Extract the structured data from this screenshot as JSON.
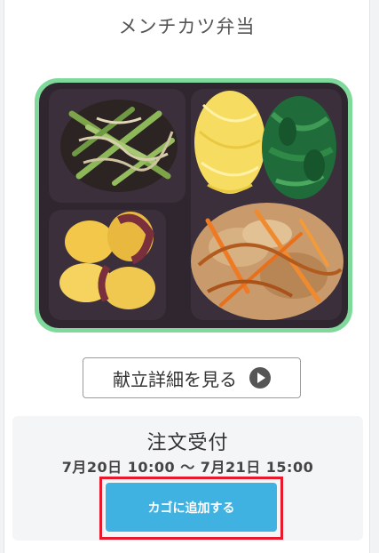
{
  "product": {
    "name": "メンチカツ弁当",
    "image_alt": "メンチカツ弁当の写真"
  },
  "detail_button": {
    "label": "献立詳細を見る",
    "icon": "play-circle-icon"
  },
  "order": {
    "status": "注文受付",
    "period": "7月20日 10:00 ～ 7月21日 15:00",
    "add_to_cart_label": "カゴに追加する"
  },
  "colors": {
    "cart_button": "#3fb2e2",
    "highlight_outline": "#e8192c",
    "tray_rim": "#7fd99a",
    "tray": "#2f2630"
  }
}
